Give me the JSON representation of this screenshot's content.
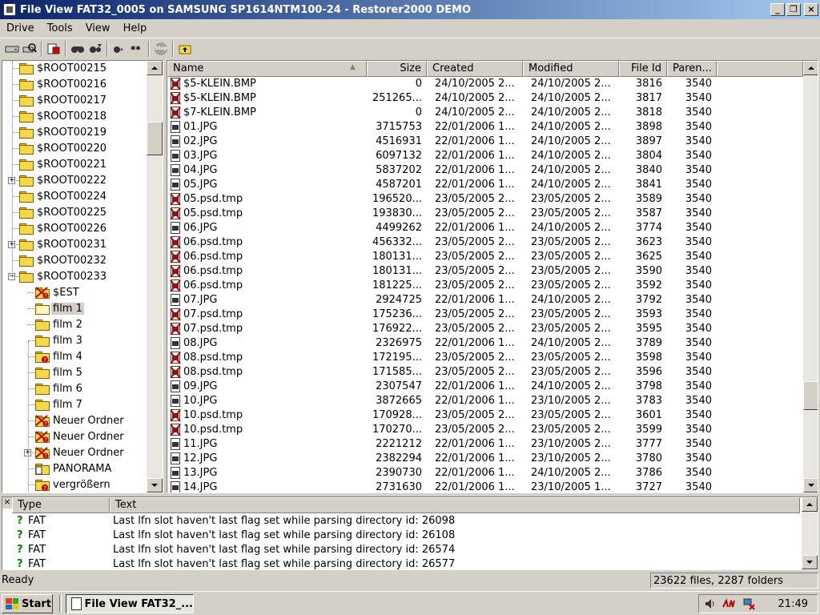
{
  "window": {
    "title": "File View FAT32_0005 on SAMSUNG SP1614NTM100-24 - Restorer2000 DEMO"
  },
  "menu": [
    "Drive",
    "Tools",
    "View",
    "Help"
  ],
  "toolbar": {
    "stop_label": "Stop"
  },
  "tree": {
    "items": [
      {
        "label": "$ROOT00215",
        "level": 0,
        "expander": "",
        "icon": "folder"
      },
      {
        "label": "$ROOT00216",
        "level": 0,
        "expander": "",
        "icon": "folder"
      },
      {
        "label": "$ROOT00217",
        "level": 0,
        "expander": "",
        "icon": "folder"
      },
      {
        "label": "$ROOT00218",
        "level": 0,
        "expander": "",
        "icon": "folder"
      },
      {
        "label": "$ROOT00219",
        "level": 0,
        "expander": "",
        "icon": "folder"
      },
      {
        "label": "$ROOT00220",
        "level": 0,
        "expander": "",
        "icon": "folder"
      },
      {
        "label": "$ROOT00221",
        "level": 0,
        "expander": "",
        "icon": "folder"
      },
      {
        "label": "$ROOT00222",
        "level": 0,
        "expander": "+",
        "icon": "folder"
      },
      {
        "label": "$ROOT00224",
        "level": 0,
        "expander": "",
        "icon": "folder"
      },
      {
        "label": "$ROOT00225",
        "level": 0,
        "expander": "",
        "icon": "folder"
      },
      {
        "label": "$ROOT00226",
        "level": 0,
        "expander": "",
        "icon": "folder"
      },
      {
        "label": "$ROOT00231",
        "level": 0,
        "expander": "+",
        "icon": "folder"
      },
      {
        "label": "$ROOT00232",
        "level": 0,
        "expander": "",
        "icon": "folder"
      },
      {
        "label": "$ROOT00233",
        "level": 0,
        "expander": "-",
        "icon": "folder"
      },
      {
        "label": "$EST",
        "level": 1,
        "expander": "",
        "icon": "folder-deleted"
      },
      {
        "label": "film 1",
        "level": 1,
        "expander": "",
        "icon": "folder-open",
        "selected": true
      },
      {
        "label": "film 2",
        "level": 1,
        "expander": "",
        "icon": "folder"
      },
      {
        "label": "film 3",
        "level": 1,
        "expander": "",
        "icon": "folder"
      },
      {
        "label": "film 4",
        "level": 1,
        "expander": "",
        "icon": "folder-question"
      },
      {
        "label": "film 5",
        "level": 1,
        "expander": "",
        "icon": "folder"
      },
      {
        "label": "film 6",
        "level": 1,
        "expander": "",
        "icon": "folder"
      },
      {
        "label": "film 7",
        "level": 1,
        "expander": "",
        "icon": "folder"
      },
      {
        "label": "Neuer Ordner",
        "level": 1,
        "expander": "",
        "icon": "folder-deleted"
      },
      {
        "label": "Neuer Ordner",
        "level": 1,
        "expander": "",
        "icon": "folder-deleted"
      },
      {
        "label": "Neuer Ordner",
        "level": 1,
        "expander": "+",
        "icon": "folder-deleted"
      },
      {
        "label": "PANORAMA",
        "level": 1,
        "expander": "",
        "icon": "folder-file"
      },
      {
        "label": "vergrößern",
        "level": 1,
        "expander": "",
        "icon": "folder-question"
      }
    ]
  },
  "list": {
    "columns": [
      "Name",
      "Size",
      "Created",
      "Modified",
      "File Id",
      "Paren..."
    ],
    "rows": [
      {
        "name": "$5-KLEIN.BMP",
        "size": "0",
        "created": "24/10/2005 2...",
        "modified": "24/10/2005 2...",
        "id": "3816",
        "parent": "3540",
        "deleted": true
      },
      {
        "name": "$5-KLEIN.BMP",
        "size": "251265...",
        "created": "24/10/2005 2...",
        "modified": "24/10/2005 2...",
        "id": "3817",
        "parent": "3540",
        "deleted": true
      },
      {
        "name": "$7-KLEIN.BMP",
        "size": "0",
        "created": "24/10/2005 2...",
        "modified": "24/10/2005 2...",
        "id": "3818",
        "parent": "3540",
        "deleted": true
      },
      {
        "name": "01.JPG",
        "size": "3715753",
        "created": "22/01/2006 1...",
        "modified": "24/10/2005 2...",
        "id": "3898",
        "parent": "3540",
        "deleted": false
      },
      {
        "name": "02.JPG",
        "size": "4516931",
        "created": "22/01/2006 1...",
        "modified": "24/10/2005 2...",
        "id": "3897",
        "parent": "3540",
        "deleted": false
      },
      {
        "name": "03.JPG",
        "size": "6097132",
        "created": "22/01/2006 1...",
        "modified": "24/10/2005 2...",
        "id": "3804",
        "parent": "3540",
        "deleted": false
      },
      {
        "name": "04.JPG",
        "size": "5837202",
        "created": "22/01/2006 1...",
        "modified": "24/10/2005 2...",
        "id": "3840",
        "parent": "3540",
        "deleted": false
      },
      {
        "name": "05.JPG",
        "size": "4587201",
        "created": "22/01/2006 1...",
        "modified": "24/10/2005 2...",
        "id": "3841",
        "parent": "3540",
        "deleted": false
      },
      {
        "name": "05.psd.tmp",
        "size": "196520...",
        "created": "23/05/2005 2...",
        "modified": "23/05/2005 2...",
        "id": "3589",
        "parent": "3540",
        "deleted": true
      },
      {
        "name": "05.psd.tmp",
        "size": "193830...",
        "created": "23/05/2005 2...",
        "modified": "23/05/2005 2...",
        "id": "3587",
        "parent": "3540",
        "deleted": true
      },
      {
        "name": "06.JPG",
        "size": "4499262",
        "created": "22/01/2006 1...",
        "modified": "24/10/2005 2...",
        "id": "3774",
        "parent": "3540",
        "deleted": false
      },
      {
        "name": "06.psd.tmp",
        "size": "456332...",
        "created": "23/05/2005 2...",
        "modified": "23/05/2005 2...",
        "id": "3623",
        "parent": "3540",
        "deleted": true
      },
      {
        "name": "06.psd.tmp",
        "size": "180131...",
        "created": "23/05/2005 2...",
        "modified": "23/05/2005 2...",
        "id": "3625",
        "parent": "3540",
        "deleted": true
      },
      {
        "name": "06.psd.tmp",
        "size": "180131...",
        "created": "23/05/2005 2...",
        "modified": "23/05/2005 2...",
        "id": "3590",
        "parent": "3540",
        "deleted": true
      },
      {
        "name": "06.psd.tmp",
        "size": "181225...",
        "created": "23/05/2005 2...",
        "modified": "23/05/2005 2...",
        "id": "3592",
        "parent": "3540",
        "deleted": true
      },
      {
        "name": "07.JPG",
        "size": "2924725",
        "created": "22/01/2006 1...",
        "modified": "24/10/2005 2...",
        "id": "3792",
        "parent": "3540",
        "deleted": false
      },
      {
        "name": "07.psd.tmp",
        "size": "175236...",
        "created": "23/05/2005 2...",
        "modified": "23/05/2005 2...",
        "id": "3593",
        "parent": "3540",
        "deleted": true
      },
      {
        "name": "07.psd.tmp",
        "size": "176922...",
        "created": "23/05/2005 2...",
        "modified": "23/05/2005 2...",
        "id": "3595",
        "parent": "3540",
        "deleted": true
      },
      {
        "name": "08.JPG",
        "size": "2326975",
        "created": "22/01/2006 1...",
        "modified": "24/10/2005 2...",
        "id": "3789",
        "parent": "3540",
        "deleted": false
      },
      {
        "name": "08.psd.tmp",
        "size": "172195...",
        "created": "23/05/2005 2...",
        "modified": "23/05/2005 2...",
        "id": "3598",
        "parent": "3540",
        "deleted": true
      },
      {
        "name": "08.psd.tmp",
        "size": "171585...",
        "created": "23/05/2005 2...",
        "modified": "23/05/2005 2...",
        "id": "3596",
        "parent": "3540",
        "deleted": true
      },
      {
        "name": "09.JPG",
        "size": "2307547",
        "created": "22/01/2006 1...",
        "modified": "24/10/2005 2...",
        "id": "3798",
        "parent": "3540",
        "deleted": false
      },
      {
        "name": "10.JPG",
        "size": "3872665",
        "created": "22/01/2006 1...",
        "modified": "23/10/2005 2...",
        "id": "3783",
        "parent": "3540",
        "deleted": false
      },
      {
        "name": "10.psd.tmp",
        "size": "170928...",
        "created": "23/05/2005 2...",
        "modified": "23/05/2005 2...",
        "id": "3601",
        "parent": "3540",
        "deleted": true
      },
      {
        "name": "10.psd.tmp",
        "size": "170270...",
        "created": "23/05/2005 2...",
        "modified": "23/05/2005 2...",
        "id": "3599",
        "parent": "3540",
        "deleted": true
      },
      {
        "name": "11.JPG",
        "size": "2221212",
        "created": "22/01/2006 1...",
        "modified": "23/10/2005 2...",
        "id": "3777",
        "parent": "3540",
        "deleted": false
      },
      {
        "name": "12.JPG",
        "size": "2382294",
        "created": "22/01/2006 1...",
        "modified": "23/10/2005 2...",
        "id": "3780",
        "parent": "3540",
        "deleted": false
      },
      {
        "name": "13.JPG",
        "size": "2390730",
        "created": "22/01/2006 1...",
        "modified": "24/10/2005 2...",
        "id": "3786",
        "parent": "3540",
        "deleted": false
      },
      {
        "name": "14.JPG",
        "size": "2731630",
        "created": "22/01/2006 1...",
        "modified": "23/10/2005 1...",
        "id": "3727",
        "parent": "3540",
        "deleted": false
      }
    ]
  },
  "log": {
    "close_glyph": "×",
    "columns": [
      "Type",
      "Text"
    ],
    "rows": [
      {
        "type": "FAT",
        "text": "Last lfn slot haven't last flag set while parsing directory id: 26098"
      },
      {
        "type": "FAT",
        "text": "Last lfn slot haven't last flag set while parsing directory id: 26108"
      },
      {
        "type": "FAT",
        "text": "Last lfn slot haven't last flag set while parsing directory id: 26574"
      },
      {
        "type": "FAT",
        "text": "Last lfn slot haven't last flag set while parsing directory id: 26577"
      }
    ]
  },
  "status": {
    "left": "Ready",
    "right": "23622 files, 2287 folders"
  },
  "taskbar": {
    "start": "Start",
    "task": "File View FAT32_...",
    "clock": "21:49"
  },
  "colors": {
    "title_start": "#0a246a",
    "title_end": "#a6caf0",
    "deleted_red": "#c00000",
    "log_ok": "#008000"
  }
}
